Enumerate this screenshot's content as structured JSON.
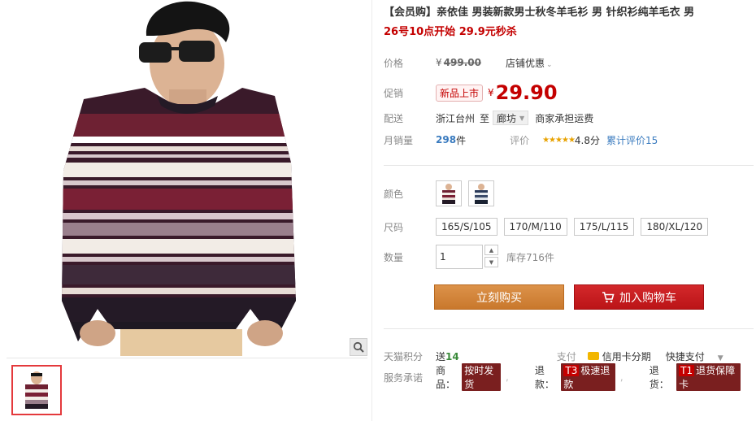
{
  "product": {
    "title": "【会员购】亲依佳 男装新款男士秋冬羊毛衫 男 针织衫纯羊毛衣 男",
    "subtitle": "26号10点开始 29.9元秒杀"
  },
  "price": {
    "label": "价格",
    "currency": "¥",
    "original": "499.00",
    "shop_discount": "店铺优惠"
  },
  "promo": {
    "label": "促销",
    "badge": "新品上市",
    "currency": "¥",
    "price": "29.90"
  },
  "shipping": {
    "label": "配送",
    "origin": "浙江台州",
    "to": "至",
    "destination": "廊坊",
    "fee": "商家承担运费"
  },
  "sales": {
    "label": "月销量",
    "count": "298",
    "unit": "件",
    "rating_label": "评价",
    "stars": "★★★★★",
    "score": "4.8分",
    "reviews": "累计评价15"
  },
  "options": {
    "color_label": "颜色",
    "size_label": "尺码",
    "sizes": [
      "165/S/105",
      "170/M/110",
      "175/L/115",
      "180/XL/120"
    ],
    "qty_label": "数量",
    "qty_value": "1",
    "stock": "库存716件"
  },
  "actions": {
    "buy_now": "立刻购买",
    "add_to_cart": "加入购物车"
  },
  "extras": {
    "points_label": "天猫积分",
    "points_prefix": "送",
    "points_value": "14",
    "pay_label": "支付",
    "credit": "信用卡分期",
    "quick_pay": "快捷支付",
    "service_label": "服务承诺",
    "services": [
      {
        "prefix": "商品：",
        "tag": "按时发货",
        "code": ""
      },
      {
        "prefix": "退款：",
        "tag": "极速退款",
        "code": "T3"
      },
      {
        "prefix": "退货：",
        "tag": "退货保障卡",
        "code": "T1"
      }
    ]
  },
  "colors": {
    "accent_red": "#c40000",
    "buy_orange": "#cd8034",
    "cart_red": "#c8191c",
    "link_blue": "#3a7bbf",
    "star_gold": "#e8a200"
  },
  "icons": {
    "zoom": "magnifier-icon",
    "cart": "cart-icon",
    "card": "credit-card-icon"
  }
}
